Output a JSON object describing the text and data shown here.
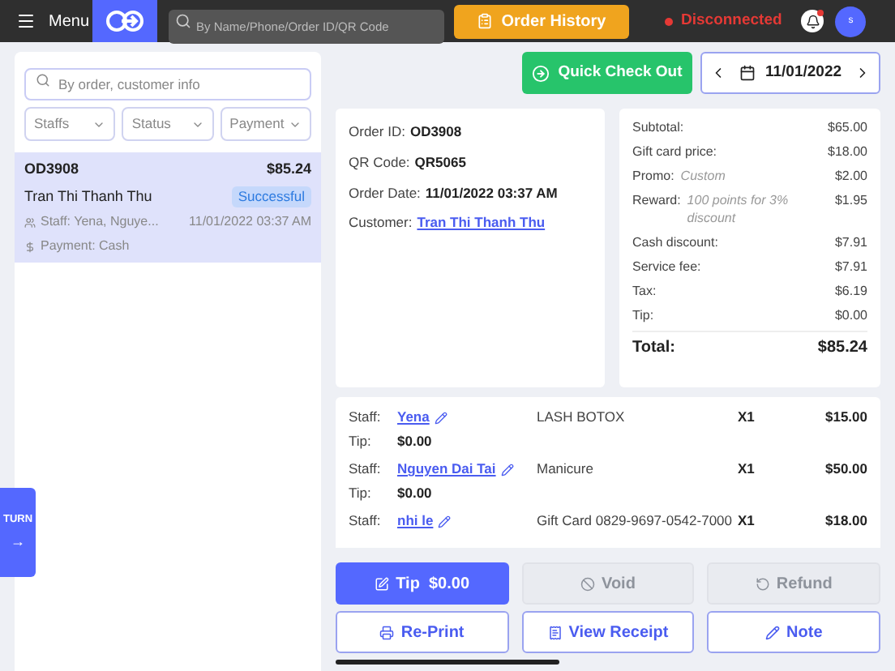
{
  "header": {
    "menu_label": "Menu",
    "search": {
      "placeholder": "By Name/Phone/Order ID/QR Code"
    },
    "order_history": "Order History",
    "connection": {
      "label": "Disconnected",
      "connected": false
    },
    "notification": {
      "unread": true
    },
    "avatar": "s"
  },
  "sidebar": {
    "search": {
      "placeholder": "By order, customer info"
    },
    "filters": [
      {
        "label": "Staffs"
      },
      {
        "label": "Status"
      },
      {
        "label": "Payment"
      }
    ],
    "orders": [
      {
        "id": "OD3908",
        "total": "$85.24",
        "customer": "Tran Thi Thanh Thu",
        "status": "Successful",
        "staff": "Staff: Yena, Nguye...",
        "date": "11/01/2022 03:37 AM",
        "payment": "Payment: Cash",
        "selected": true
      }
    ],
    "turn_tab": {
      "label": "TURN",
      "arrow": "→"
    }
  },
  "toolbar": {
    "quick_checkout": "Quick Check Out",
    "date": "11/01/2022"
  },
  "order_info": [
    {
      "label": "Order ID:",
      "value": "OD3908",
      "kind": "text"
    },
    {
      "label": "QR Code:",
      "value": "QR5065",
      "kind": "text"
    },
    {
      "label": "Order Date:",
      "value": "11/01/2022 03:37 AM",
      "kind": "text"
    },
    {
      "label": "Customer:",
      "value": "Tran Thi Thanh Thu",
      "kind": "link"
    }
  ],
  "summary": [
    {
      "label": "Subtotal:",
      "value": "$65.00",
      "kind": "line"
    },
    {
      "label": "Gift card price:",
      "value": "$18.00",
      "kind": "line"
    },
    {
      "label": "Promo:",
      "note": "Custom",
      "value": "$2.00",
      "kind": "line"
    },
    {
      "label": "Reward:",
      "note": "100 points for 3% discount",
      "value": "$1.95",
      "kind": "line"
    },
    {
      "label": "Cash discount:",
      "value": "$7.91",
      "kind": "line"
    },
    {
      "label": "Service fee:",
      "value": "$7.91",
      "kind": "line"
    },
    {
      "label": "Tax:",
      "value": "$6.19",
      "kind": "line"
    },
    {
      "label": "Tip:",
      "value": "$0.00",
      "kind": "line"
    },
    {
      "label": "Total:",
      "value": "$85.24",
      "kind": "total"
    }
  ],
  "items": [
    {
      "staff_label": "Staff:",
      "staff": "Yena",
      "service": "LASH BOTOX",
      "qty": "X1",
      "price": "$15.00",
      "tip_label": "Tip:",
      "tip": "$0.00"
    },
    {
      "staff_label": "Staff:",
      "staff": "Nguyen Dai Tai",
      "service": "Manicure",
      "qty": "X1",
      "price": "$50.00",
      "tip_label": "Tip:",
      "tip": "$0.00"
    },
    {
      "staff_label": "Staff:",
      "staff": "nhi le",
      "service": "Gift Card 0829-9697-0542-7000",
      "qty": "X1",
      "price": "$18.00"
    }
  ],
  "actions": [
    {
      "label": "Tip  $0.00",
      "kind": "primary",
      "disabled": false
    },
    {
      "label": "Void",
      "kind": "plain",
      "disabled": true
    },
    {
      "label": "Refund",
      "kind": "plain",
      "disabled": true
    },
    {
      "label": "Re-Print",
      "kind": "outline",
      "disabled": false
    },
    {
      "label": "View Receipt",
      "kind": "outline",
      "disabled": false
    },
    {
      "label": "Note",
      "kind": "outline",
      "disabled": false
    }
  ]
}
